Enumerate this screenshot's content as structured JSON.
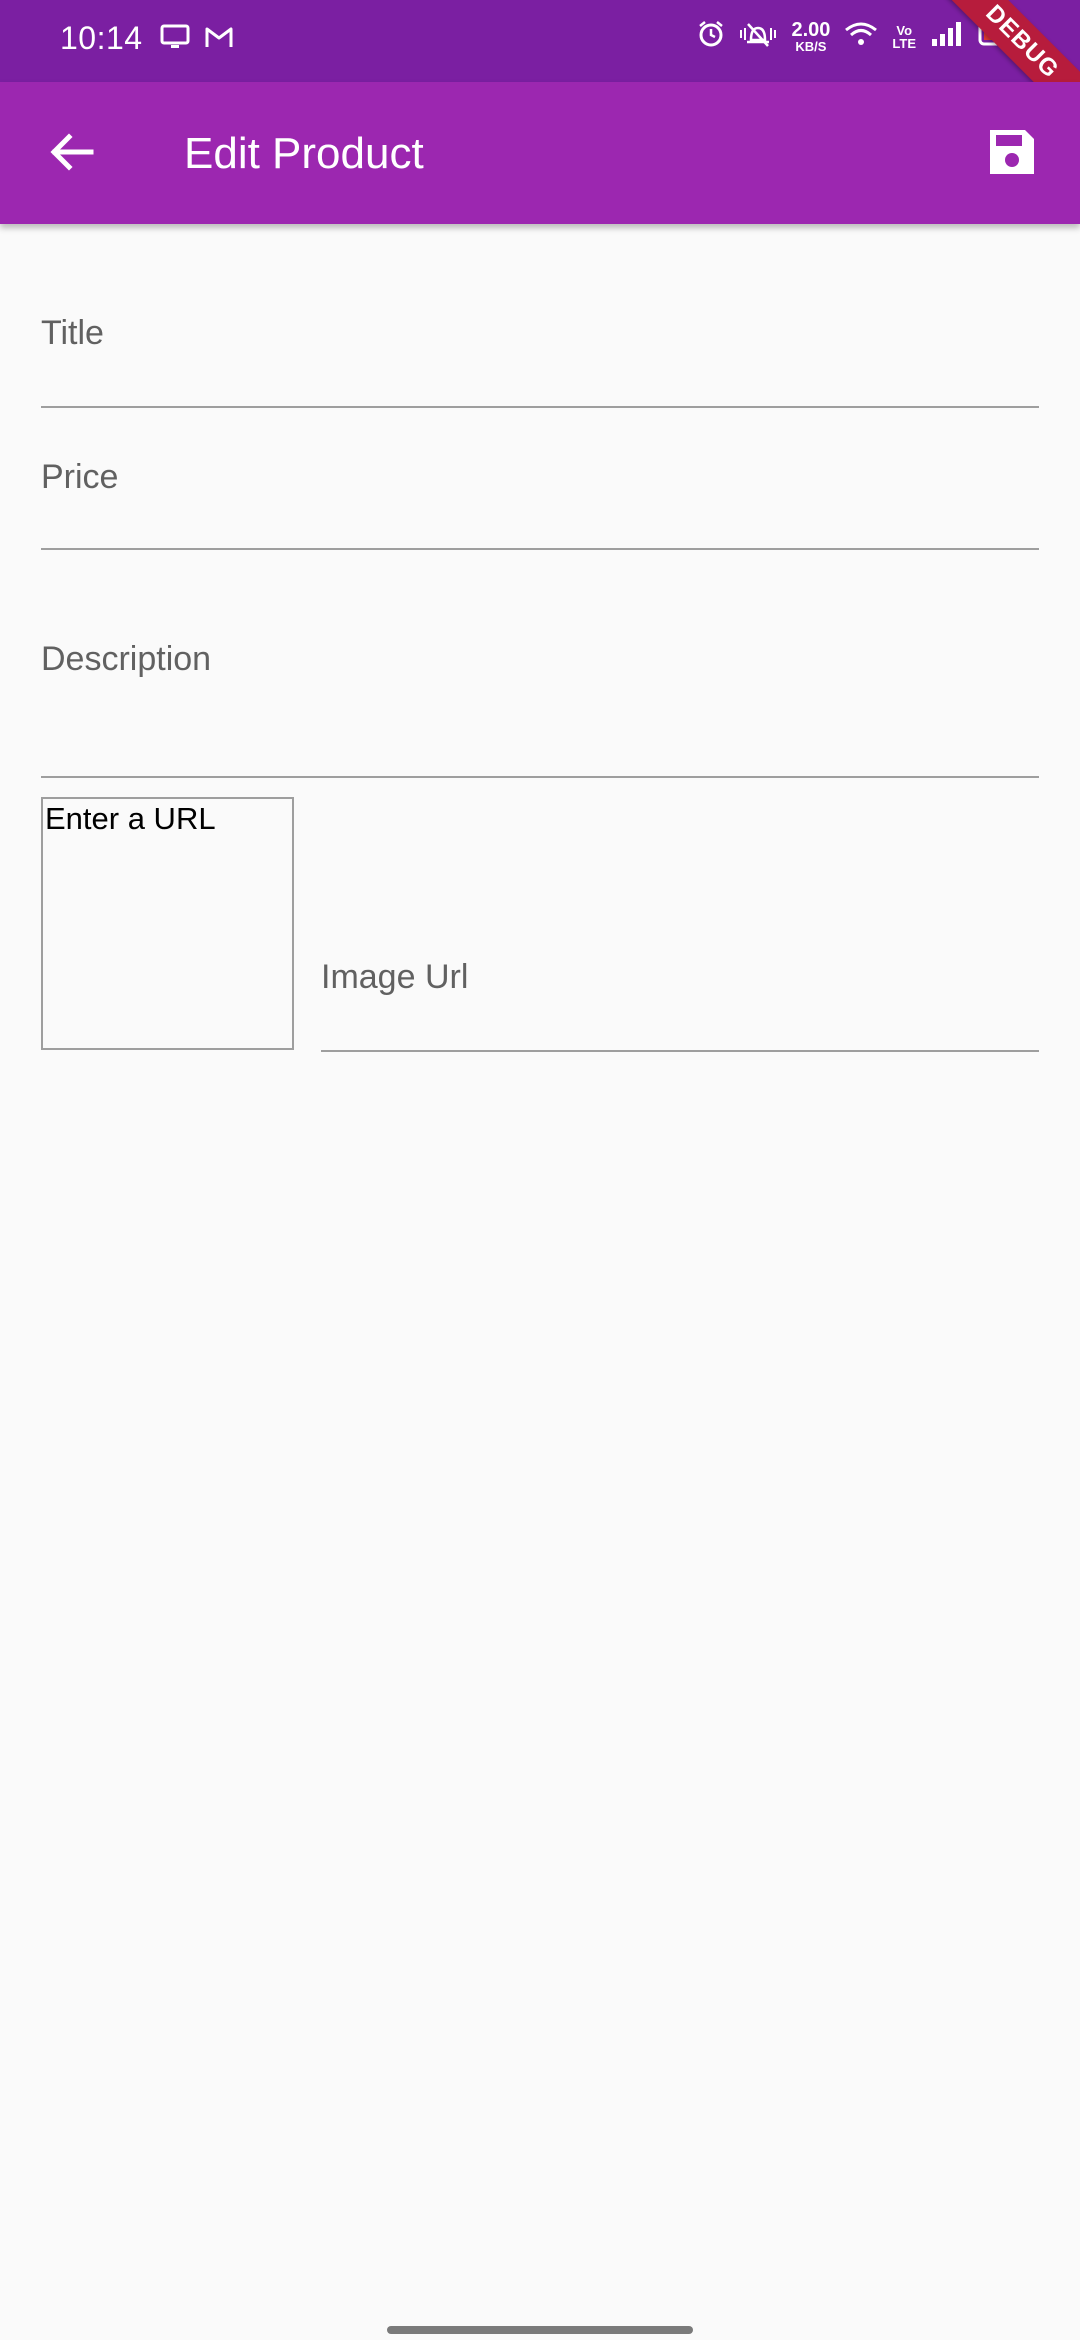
{
  "status_bar": {
    "time": "10:14",
    "speed_value": "2.00",
    "speed_unit": "KB/S",
    "volte_top": "Vo",
    "volte_bottom": "LTE",
    "debug_banner": "DEBUG",
    "left_icons": [
      "monitor-icon",
      "gmail-icon"
    ],
    "right_icons": [
      "alarm-icon",
      "vibrate-mute-icon",
      "wifi-icon",
      "signal-icon",
      "battery-icon"
    ]
  },
  "app_bar": {
    "title": "Edit Product",
    "back_icon": "arrow-back-icon",
    "save_icon": "save-icon",
    "background_color": "#9c27b0",
    "status_color": "#7b1fa2"
  },
  "form": {
    "title_label": "Title",
    "price_label": "Price",
    "description_label": "Description",
    "image_preview_text": "Enter a URL",
    "image_url_label": "Image Url"
  }
}
